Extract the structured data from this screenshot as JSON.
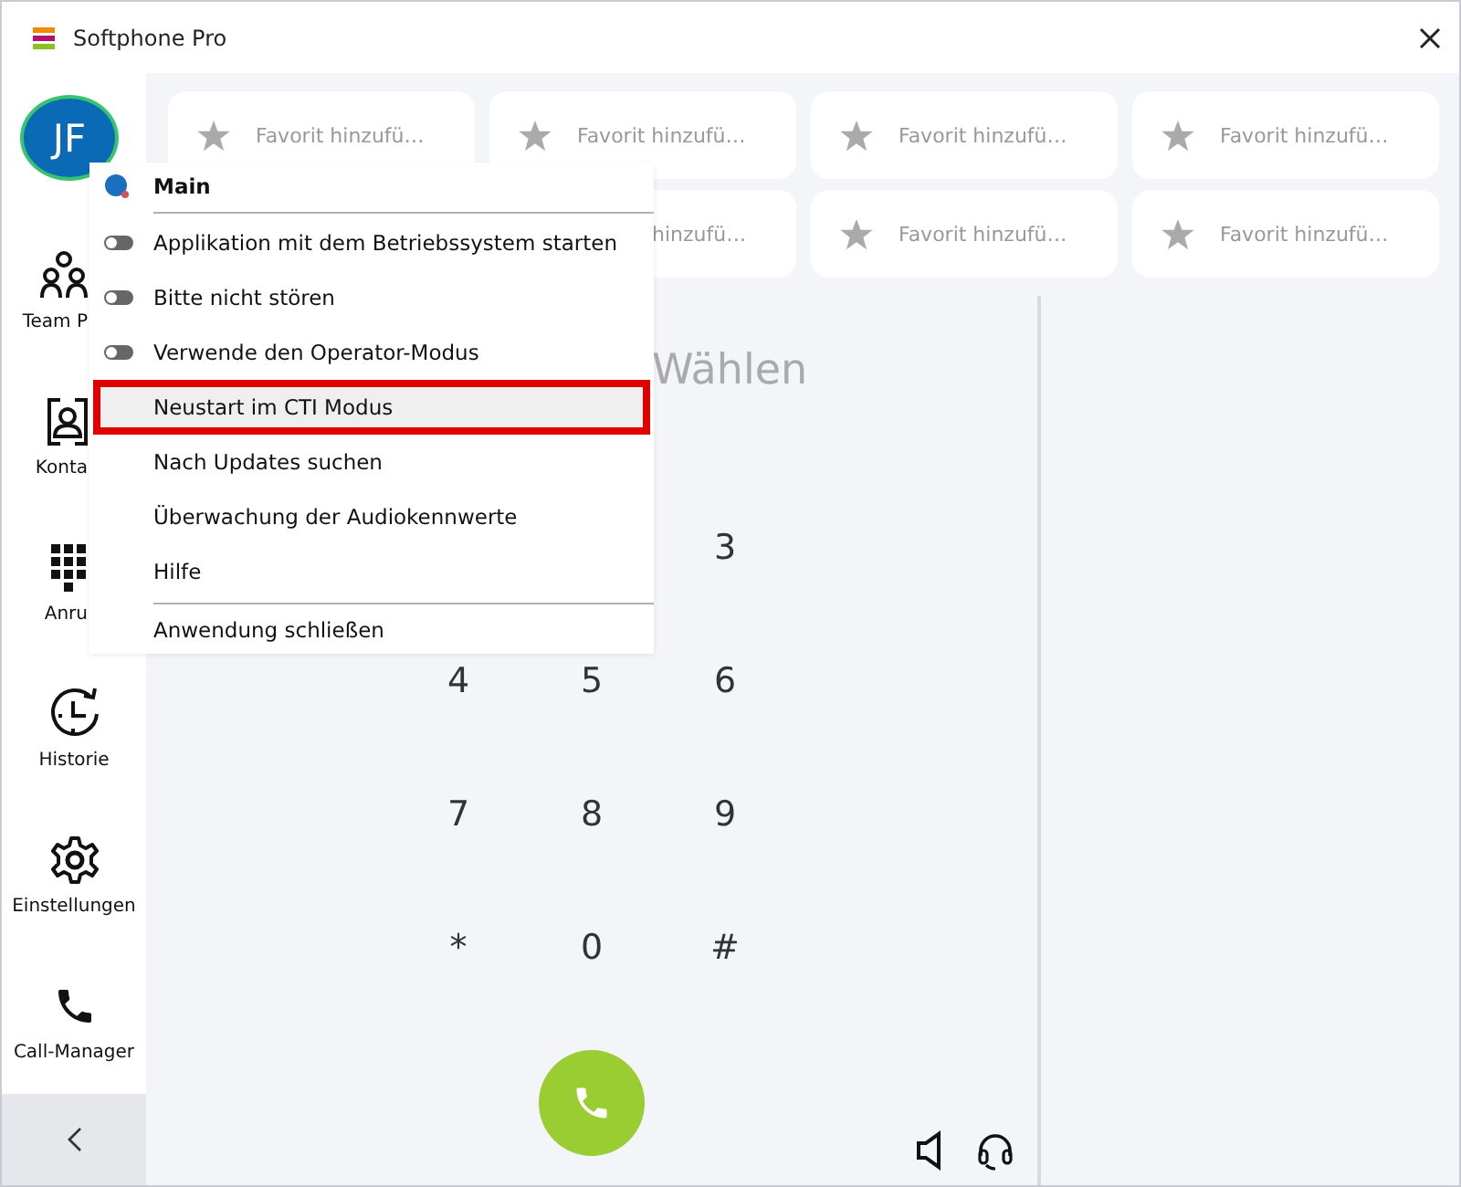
{
  "window": {
    "title": "Softphone Pro"
  },
  "avatar": {
    "initials": "JF"
  },
  "sidebar": {
    "items": [
      {
        "label": "Team P",
        "covered": true
      },
      {
        "label": "Konta",
        "covered": true
      },
      {
        "label": "Anru",
        "covered": true
      },
      {
        "label": "Historie",
        "covered": false
      },
      {
        "label": "Einstellungen",
        "covered": false
      },
      {
        "label": "Call-Manager",
        "covered": false
      }
    ]
  },
  "favorites": [
    {
      "label": "Favorit hinzufü…",
      "covered": false
    },
    {
      "label": "Favorit hinzufü…",
      "covered": false
    },
    {
      "label": "Favorit hinzufü…",
      "covered": false
    },
    {
      "label": "Favorit hinzufü…",
      "covered": false
    },
    {
      "label": "hinzufü…",
      "covered": true
    },
    {
      "label": "Favorit hinzufü…",
      "covered": false
    },
    {
      "label": "Favorit hinzufü…",
      "covered": false
    }
  ],
  "dialer": {
    "hint": "Wählen",
    "keys": [
      "3",
      "4",
      "5",
      "6",
      "7",
      "8",
      "9",
      "*",
      "0",
      "#"
    ]
  },
  "menu": {
    "items": [
      {
        "kind": "header",
        "label": "Main"
      },
      {
        "kind": "divider"
      },
      {
        "kind": "toggle",
        "label": "Applikation mit dem Betriebssystem starten",
        "on": false
      },
      {
        "kind": "toggle",
        "label": "Bitte nicht stören",
        "on": false
      },
      {
        "kind": "toggle",
        "label": "Verwende den Operator-Modus",
        "on": false
      },
      {
        "kind": "action",
        "label": "Neustart im CTI Modus",
        "selected": true
      },
      {
        "kind": "action",
        "label": "Nach Updates suchen",
        "selected": false
      },
      {
        "kind": "action",
        "label": "Überwachung der Audiokennwerte",
        "selected": false
      },
      {
        "kind": "action",
        "label": "Hilfe",
        "selected": false
      },
      {
        "kind": "divider"
      },
      {
        "kind": "action",
        "label": "Anwendung schließen",
        "selected": false
      }
    ]
  }
}
